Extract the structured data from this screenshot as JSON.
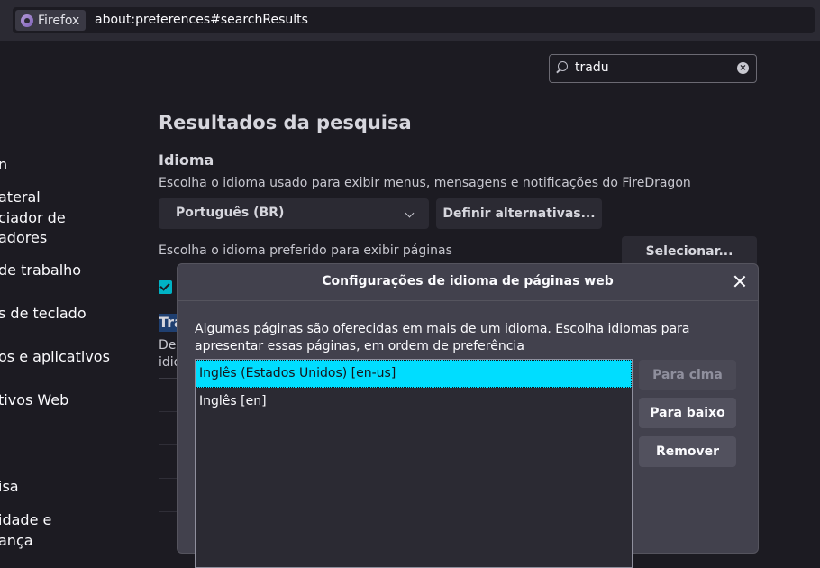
{
  "urlbar": {
    "identity_label": "Firefox",
    "url": "about:preferences#searchResults"
  },
  "sidebar": {
    "items": [
      "n",
      "ateral",
      "ciador de",
      "adores",
      "de trabalho",
      "s de teclado",
      "os e aplicativos",
      "tivos Web",
      "isa",
      "idade e",
      "ança"
    ]
  },
  "search": {
    "value": "tradu"
  },
  "main": {
    "title": "Resultados da pesquisa",
    "section_title": "Idioma",
    "language_desc": "Escolha o idioma usado para exibir menus, mensagens e notificações do FireDragon",
    "language_value": "Português (BR)",
    "alternatives_button": "Definir alternativas...",
    "pages_desc": "Escolha o idioma preferido para exibir páginas",
    "select_button": "Selecionar...",
    "translation_fragment": "Tra",
    "fragment1": "De",
    "fragment2": "idio"
  },
  "dialog": {
    "title": "Configurações de idioma de páginas web",
    "description": "Algumas páginas são oferecidas em mais de um idioma. Escolha idiomas para apresentar essas páginas, em ordem de preferência",
    "languages": [
      "Inglês (Estados Unidos) [en-us]",
      "Inglês [en]"
    ],
    "move_up": "Para cima",
    "move_down": "Para baixo",
    "remove": "Remover"
  },
  "colors": {
    "accent": "#00ddff",
    "checkbox": "#00b3c5",
    "background": "#1c1b22",
    "dialog": "#42414d"
  }
}
